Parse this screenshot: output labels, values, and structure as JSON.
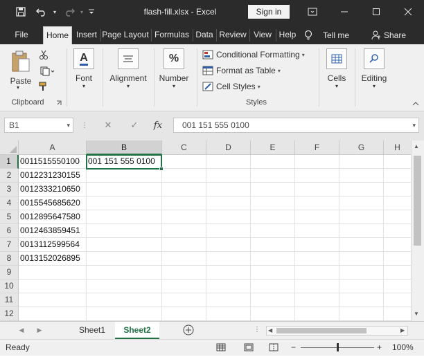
{
  "title_bar": {
    "title": "flash-fill.xlsx  -  Excel",
    "sign_in_label": "Sign in",
    "icons": [
      "save-icon",
      "undo-icon",
      "redo-icon",
      "customize-icon",
      "ribbon-display-icon",
      "minimize-icon",
      "restore-icon",
      "close-icon"
    ]
  },
  "tabs": [
    {
      "label": "File"
    },
    {
      "label": "Home",
      "active": true
    },
    {
      "label": "Insert"
    },
    {
      "label": "Page Layout"
    },
    {
      "label": "Formulas"
    },
    {
      "label": "Data"
    },
    {
      "label": "Review"
    },
    {
      "label": "View"
    },
    {
      "label": "Help"
    }
  ],
  "tell_me": "Tell me",
  "share": "Share",
  "ribbon": {
    "clipboard": {
      "paste": "Paste",
      "group": "Clipboard"
    },
    "font": "Font",
    "alignment": "Alignment",
    "number": "Number",
    "styles": {
      "conditional": "Conditional Formatting",
      "table": "Format as Table",
      "cell_styles": "Cell Styles",
      "group": "Styles"
    },
    "cells": "Cells",
    "editing": "Editing"
  },
  "formula_bar": {
    "name_box": "B1",
    "formula": "001 151 555 0100",
    "fx": "fx"
  },
  "grid": {
    "columns": [
      "A",
      "B",
      "C",
      "D",
      "E",
      "F",
      "G",
      "H"
    ],
    "selected_column": "B",
    "rows": [
      "1",
      "2",
      "3",
      "4",
      "5",
      "6",
      "7",
      "8",
      "9",
      "10",
      "11",
      "12"
    ],
    "selected_row": "1",
    "col_a": [
      "0011515550100",
      "0012231230155",
      "0012333210650",
      "0015545685620",
      "0012895647580",
      "0012463859451",
      "0013112599564",
      "0013152026895"
    ],
    "b1": "001 151 555 0100"
  },
  "sheets": [
    {
      "label": "Sheet1"
    },
    {
      "label": "Sheet2",
      "active": true
    }
  ],
  "status": {
    "ready": "Ready",
    "zoom": "100%"
  },
  "colors": {
    "accent": "#217346",
    "titlebar": "#2b2b2b"
  }
}
